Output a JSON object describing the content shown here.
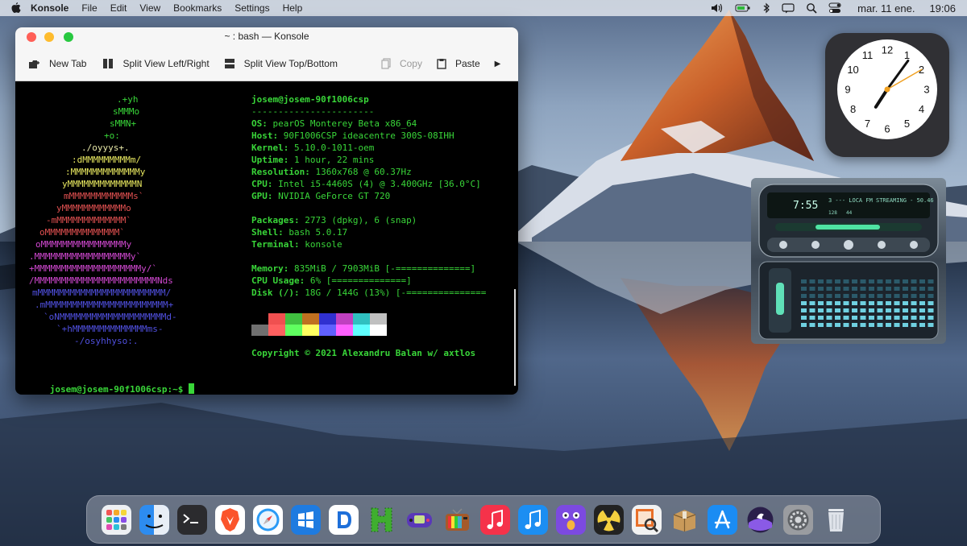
{
  "menubar": {
    "app_name": "Konsole",
    "menus": [
      "File",
      "Edit",
      "View",
      "Bookmarks",
      "Settings",
      "Help"
    ],
    "date": "mar. 11 ene.",
    "time": "19:06"
  },
  "window": {
    "title": "~ : bash — Konsole",
    "toolbar": {
      "new_tab": "New Tab",
      "split_lr": "Split View Left/Right",
      "split_tb": "Split View Top/Bottom",
      "copy": "Copy",
      "paste": "Paste",
      "more": "▶"
    }
  },
  "terminal": {
    "logo_lines": [
      {
        "text": ".+yh",
        "color": "#39d639"
      },
      {
        "text": "sMMMo",
        "color": "#39d639"
      },
      {
        "text": "sMMN+",
        "color": "#39d639"
      },
      {
        "text": "+o:",
        "color": "#39d639"
      },
      {
        "text": "./oyyys+.",
        "color": "#e8e8a8"
      },
      {
        "text": ":dMMMMMMMMMm/",
        "color": "#e8e860"
      },
      {
        "text": ":MMMMMMMMMMMMMy",
        "color": "#e8e860"
      },
      {
        "text": "yMMMMMMMMMMMMMN",
        "color": "#e8e860"
      },
      {
        "text": "mMMMMMMMMMMMMs`",
        "color": "#e05050"
      },
      {
        "text": "yMMMMMMMMMMMMo",
        "color": "#e05050"
      },
      {
        "text": "-mMMMMMMMMMMMMM`",
        "color": "#e05050"
      },
      {
        "text": "oMMMMMMMMMMMMMM`",
        "color": "#e05050"
      },
      {
        "text": "oMMMMMMMMMMMMMMMMy",
        "color": "#d048d0"
      },
      {
        "text": ".MMMMMMMMMMMMMMMMMMy`",
        "color": "#d048d0"
      },
      {
        "text": "+MMMMMMMMMMMMMMMMMMMMy/`",
        "color": "#d048d0"
      },
      {
        "text": "/MMMMMMMMMMMMMMMMMMMMMMMNds",
        "color": "#d048d0"
      },
      {
        "text": "mMMMMMMMMMMMMMMMMMMMMMMMM/",
        "color": "#5050e0"
      },
      {
        "text": ".mMMMMMMMMMMMMMMMMMMMMMMM+",
        "color": "#5050e0"
      },
      {
        "text": "`oNMMMMMMMMMMMMMMMMMMMMd-",
        "color": "#5050e0"
      },
      {
        "text": "`+hMMMMMMMMMMMMMMms-",
        "color": "#5050e0"
      },
      {
        "text": "-/osyhhyso:.",
        "color": "#5050e0"
      }
    ],
    "user_host": "josem@josem-90f1006csp",
    "separator": "-----------------------",
    "info": [
      {
        "key": "OS",
        "value": "pearOS Monterey Beta x86_64"
      },
      {
        "key": "Host",
        "value": "90F1006CSP ideacentre 300S-08IHH"
      },
      {
        "key": "Kernel",
        "value": "5.10.0-1011-oem"
      },
      {
        "key": "Uptime",
        "value": "1 hour, 22 mins"
      },
      {
        "key": "Resolution",
        "value": "1360x768 @ 60.37Hz"
      },
      {
        "key": "CPU",
        "value": "Intel i5-4460S (4) @ 3.400GHz [36.0°C]"
      },
      {
        "key": "GPU",
        "value": "NVIDIA GeForce GT 720"
      },
      {
        "key": "Packages",
        "value": "2773 (dpkg), 6 (snap)"
      },
      {
        "key": "Shell",
        "value": "bash 5.0.17"
      },
      {
        "key": "Terminal",
        "value": "konsole"
      },
      {
        "key": "Memory",
        "value": "835MiB / 7903MiB [-==============]"
      },
      {
        "key": "CPU Usage",
        "value": "6% [==============]"
      },
      {
        "key": "Disk (/)",
        "value": "18G / 144G (13%) [-==============="
      }
    ],
    "palette_top": [
      "#000000",
      "#f05050",
      "#40c040",
      "#c07020",
      "#3030d0",
      "#c040c0",
      "#30c0c0",
      "#c0c0c0"
    ],
    "palette_bottom": [
      "#707070",
      "#ff6060",
      "#60ff60",
      "#ffff60",
      "#6060ff",
      "#ff60ff",
      "#60ffff",
      "#ffffff"
    ],
    "copyright": "Copyright © 2021 Alexandru Balan w/ axtlos",
    "prompt": "josem@josem-90f1006csp:~$"
  },
  "clock": {
    "numbers": [
      "12",
      "1",
      "2",
      "3",
      "4",
      "5",
      "6",
      "7",
      "8",
      "9",
      "10",
      "11"
    ],
    "time_shown": "19:06"
  },
  "player": {
    "time": "7:55",
    "station": "3 --- LOCA FM STREAMING - 50.46",
    "bitrate": "128",
    "khz": "44"
  },
  "dock": {
    "apps": [
      "Launchpad",
      "Finder",
      "Terminal",
      "Brave",
      "Safari",
      "Windows",
      "Dashlane",
      "Cover",
      "Game Boy",
      "Retro TV",
      "Music",
      "Music Player",
      "Podcast Bot",
      "Nuclear",
      "Preview",
      "Archive Utility",
      "App Store",
      "Boot Camp",
      "System Preferences",
      "Trash"
    ]
  },
  "colors": {
    "accent_green": "#39d639",
    "menubar_bg": "#ebeef3",
    "window_toolbar_bg": "#f6f6f6"
  }
}
